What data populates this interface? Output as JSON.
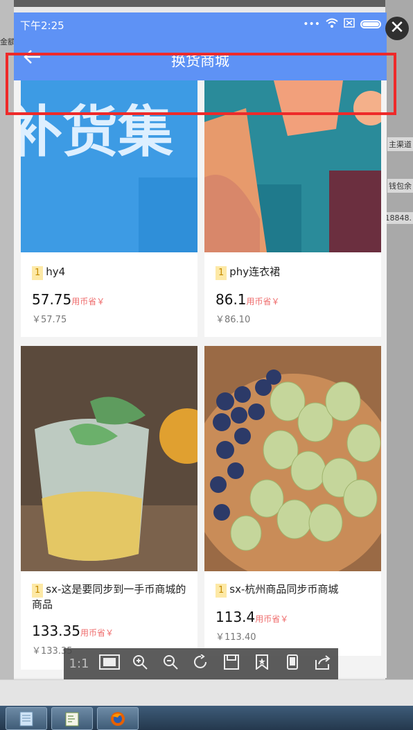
{
  "background_window": {
    "left_labels": [
      "金额"
    ],
    "right_labels": [
      "主渠道",
      "钱包余",
      "18848."
    ]
  },
  "statusbar": {
    "time": "下午2:25",
    "icons": [
      "more-dots-icon",
      "wifi-icon",
      "sim-card-icon",
      "battery-icon"
    ]
  },
  "navbar": {
    "back_icon": "arrow-left-icon",
    "title": "换货商城"
  },
  "products": [
    {
      "tag": "1",
      "name": "hy4",
      "price": "57.75",
      "price_note": "用币省￥",
      "original": "￥57.75"
    },
    {
      "tag": "1",
      "name": "phy连衣裙",
      "price": "86.1",
      "price_note": "用币省￥",
      "original": "￥86.10"
    },
    {
      "tag": "1",
      "name": "sx-这是要同步到一手币商城的商品",
      "price": "133.35",
      "price_note": "用币省￥",
      "original": "￥133.35"
    },
    {
      "tag": "1",
      "name": "sx-杭州商品同步币商城",
      "price": "113.4",
      "price_note": "用币省￥",
      "original": "￥113.40"
    }
  ],
  "image_banner_text": "补货集",
  "viewer_toolbar": {
    "ratio": "1:1",
    "tools": [
      "fit-screen-icon",
      "zoom-in-icon",
      "zoom-out-icon",
      "rotate-icon",
      "save-icon",
      "bookmark-icon",
      "phone-icon",
      "share-icon"
    ]
  },
  "colors": {
    "primary": "#5e92f5",
    "annotation": "#ee2a2a",
    "tag_bg": "#fde9a6",
    "price_note": "#ef6d6d"
  }
}
